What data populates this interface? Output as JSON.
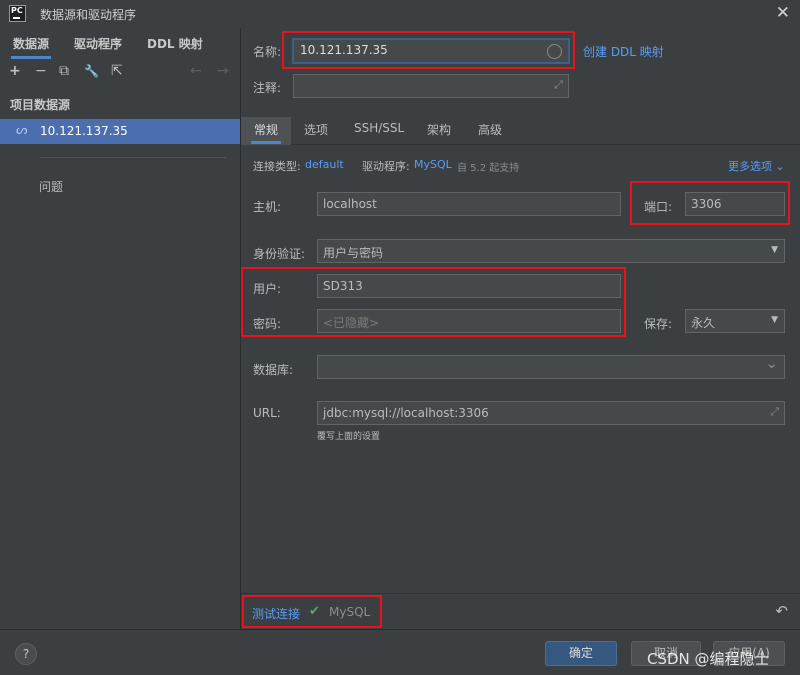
{
  "window": {
    "app_badge": "PC",
    "title": "数据源和驱动程序",
    "close": "✕"
  },
  "left": {
    "tabs": [
      "数据源",
      "驱动程序",
      "DDL 映射"
    ],
    "toolbar": {
      "add": "+",
      "remove": "−",
      "copy": "⧉",
      "settings": "🔧",
      "export": "⇱",
      "back": "←",
      "forward": "→"
    },
    "section_label": "项目数据源",
    "datasource_label": "10.121.137.35",
    "problems_label": "问题"
  },
  "form": {
    "name_label": "名称:",
    "name_value": "10.121.137.35",
    "create_ddl_link": "创建 DDL 映射",
    "comment_label": "注释:",
    "tabs": [
      "常规",
      "选项",
      "SSH/SSL",
      "架构",
      "高级"
    ],
    "conn_type_label": "连接类型:",
    "conn_type_value": "default",
    "driver_label": "驱动程序:",
    "driver_value": "MySQL",
    "driver_support": "自 5.2 起支持",
    "more_options": "更多选项 ⌄",
    "host_label": "主机:",
    "host_value": "localhost",
    "port_label": "端口:",
    "port_value": "3306",
    "auth_label": "身份验证:",
    "auth_value": "用户与密码",
    "user_label": "用户:",
    "user_value": "SD313",
    "password_label": "密码:",
    "password_placeholder": "<已隐藏>",
    "save_label": "保存:",
    "save_value": "永久",
    "database_label": "数据库:",
    "database_value": "",
    "url_label": "URL:",
    "url_value": "jdbc:mysql://localhost:3306",
    "url_hint": "覆写上面的设置"
  },
  "footer": {
    "test_connection": "测试连接",
    "test_check": "✔",
    "test_db": "MySQL",
    "revert": "↶"
  },
  "bottom": {
    "help": "?",
    "ok": "确定",
    "cancel": "取消",
    "apply": "应用(A)",
    "watermark": "CSDN @编程隐士"
  },
  "colors": {
    "accent": "#4b6eaf",
    "link": "#589df6",
    "highlight_box": "#e8131d",
    "success": "#59a869"
  }
}
